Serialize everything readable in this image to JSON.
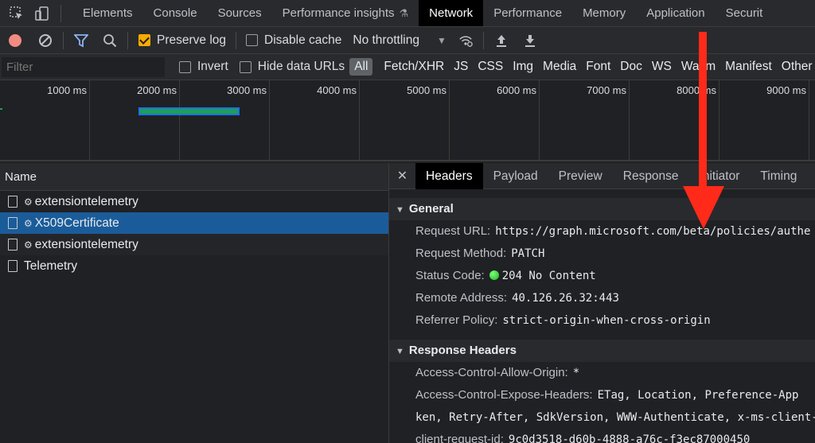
{
  "tabs": [
    {
      "label": "Elements"
    },
    {
      "label": "Console"
    },
    {
      "label": "Sources"
    },
    {
      "label": "Performance insights"
    },
    {
      "label": "Network"
    },
    {
      "label": "Performance"
    },
    {
      "label": "Memory"
    },
    {
      "label": "Application"
    },
    {
      "label": "Securit"
    }
  ],
  "toolbar": {
    "preserve_log": "Preserve log",
    "disable_cache": "Disable cache",
    "throttling": "No throttling"
  },
  "filter": {
    "placeholder": "Filter",
    "invert": "Invert",
    "hide_data_urls": "Hide data URLs",
    "types": [
      "All",
      "Fetch/XHR",
      "JS",
      "CSS",
      "Img",
      "Media",
      "Font",
      "Doc",
      "WS",
      "Wasm",
      "Manifest",
      "Other"
    ]
  },
  "overview": {
    "ticks": [
      "1000 ms",
      "2000 ms",
      "3000 ms",
      "4000 ms",
      "5000 ms",
      "6000 ms",
      "7000 ms",
      "8000 ms",
      "9000 ms"
    ]
  },
  "requests": {
    "header": "Name",
    "items": [
      {
        "name": "extensiontelemetry",
        "gear": true
      },
      {
        "name": "X509Certificate",
        "gear": true,
        "selected": true
      },
      {
        "name": "extensiontelemetry",
        "gear": true
      },
      {
        "name": "Telemetry",
        "gear": false
      }
    ]
  },
  "details": {
    "tabs": [
      "Headers",
      "Payload",
      "Preview",
      "Response",
      "Initiator",
      "Timing"
    ],
    "general": {
      "title": "General",
      "request_url_label": "Request URL:",
      "request_url": "https://graph.microsoft.com/beta/policies/authe",
      "request_method_label": "Request Method:",
      "request_method": "PATCH",
      "status_code_label": "Status Code:",
      "status_code": "204 No Content",
      "remote_address_label": "Remote Address:",
      "remote_address": "40.126.26.32:443",
      "referrer_policy_label": "Referrer Policy:",
      "referrer_policy": "strict-origin-when-cross-origin"
    },
    "response_headers": {
      "title": "Response Headers",
      "acao_label": "Access-Control-Allow-Origin:",
      "acao": "*",
      "aceh_label": "Access-Control-Expose-Headers:",
      "aceh": "ETag, Location, Preference-App",
      "aceh_cont": "ken, Retry-After, SdkVersion, WWW-Authenticate, x-ms-client-",
      "crid_label": "client-request-id:",
      "crid": "9c0d3518-d60b-4888-a76c-f3ec87000450"
    }
  },
  "colors": {
    "accent": "#f9ab00",
    "selected_row": "#1a5c9a",
    "annotation_arrow": "#ff2a1a"
  }
}
